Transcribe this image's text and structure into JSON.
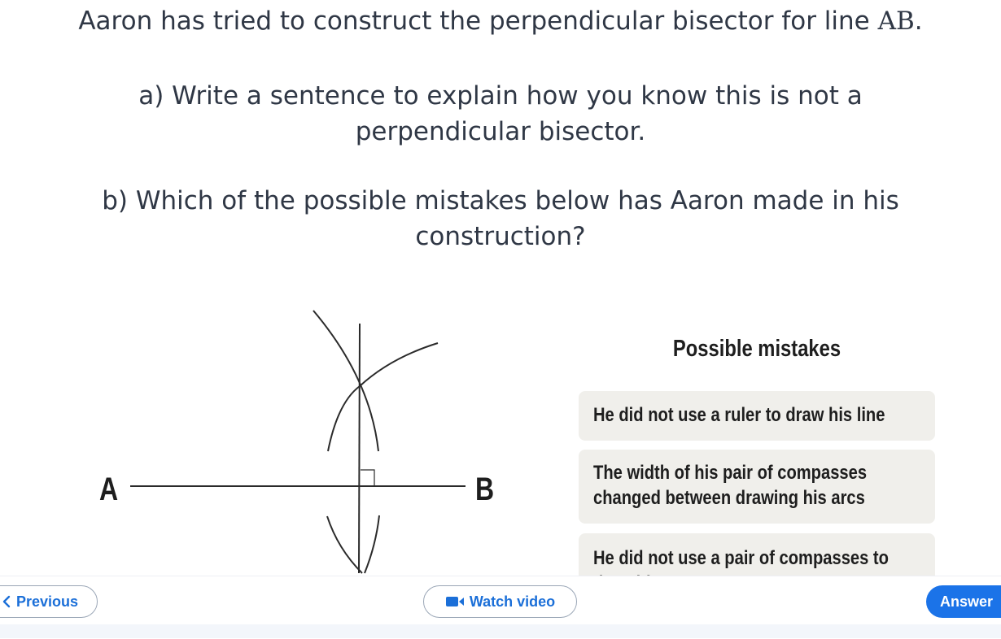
{
  "question": {
    "line1": "Aaron has tried to construct the perpendicular bisector for line ",
    "line1_math": "AB",
    "line1_end": ".",
    "part_a": "a) Write a sentence to explain how you know this is not a perpendicular bisector.",
    "part_b": "b) Which of the possible mistakes below has Aaron made in his construction?"
  },
  "diagram": {
    "label_a": "A",
    "label_b": "B"
  },
  "mistakes": {
    "title": "Possible mistakes",
    "options": [
      "He did not use a ruler to draw his line",
      "The width of his pair of compasses changed between drawing his arcs",
      "He did not use a pair of compasses to draw his arcs"
    ]
  },
  "nav": {
    "previous": "Previous",
    "watch_video": "Watch video",
    "answer": "Answer"
  },
  "colors": {
    "primary_blue": "#1b73e8",
    "option_bg": "#f0efeb"
  },
  "icons": {
    "previous": "chevron-left-icon",
    "video": "video-camera-icon"
  }
}
